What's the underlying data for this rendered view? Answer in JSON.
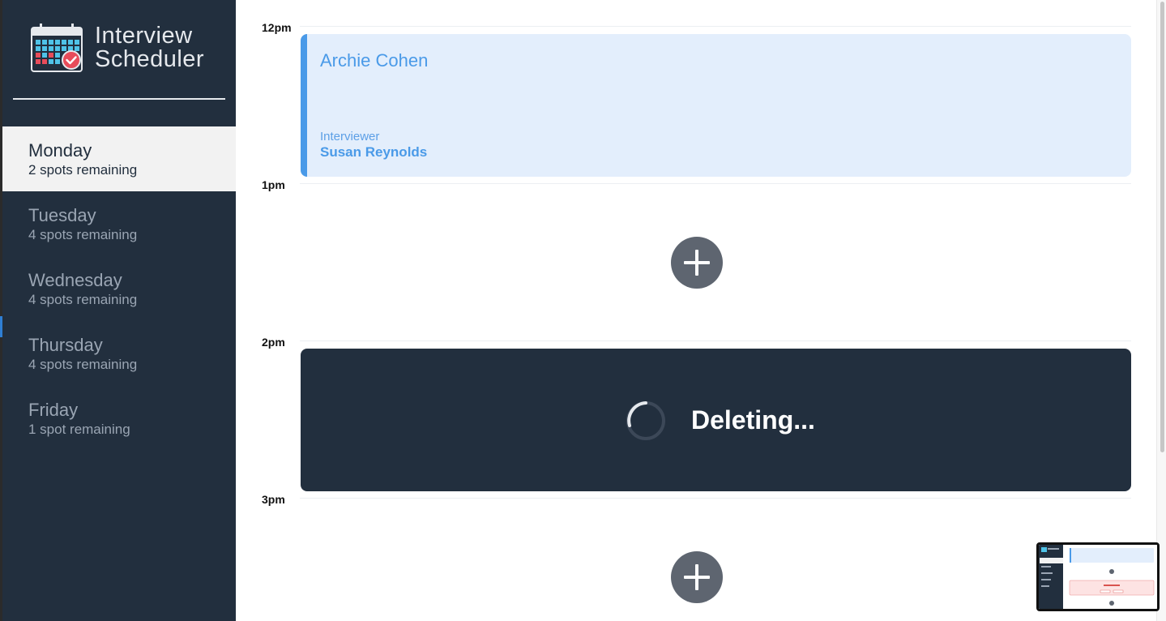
{
  "brand": {
    "line1": "Interview",
    "line2": "Scheduler"
  },
  "days": [
    {
      "name": "Monday",
      "spots": "2 spots remaining",
      "selected": true
    },
    {
      "name": "Tuesday",
      "spots": "4 spots remaining",
      "selected": false
    },
    {
      "name": "Wednesday",
      "spots": "4 spots remaining",
      "selected": false
    },
    {
      "name": "Thursday",
      "spots": "4 spots remaining",
      "selected": false
    },
    {
      "name": "Friday",
      "spots": "1 spot remaining",
      "selected": false
    }
  ],
  "schedule": {
    "hours": [
      "12pm",
      "1pm",
      "2pm",
      "3pm"
    ],
    "appointment": {
      "student": "Archie Cohen",
      "interviewer_label": "Interviewer",
      "interviewer": "Susan Reynolds"
    },
    "status": {
      "message": "Deleting..."
    }
  },
  "colors": {
    "sidebar": "#222f3e",
    "accent": "#4a9ae8",
    "appointment_bg": "#e3eefc",
    "add_button": "#5e6570"
  },
  "icons": [
    "calendar-icon",
    "plus-icon",
    "spinner-icon"
  ]
}
